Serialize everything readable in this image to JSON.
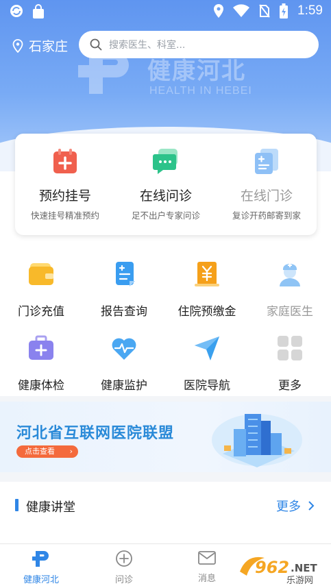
{
  "status_bar": {
    "time": "1:59"
  },
  "header": {
    "city": "石家庄",
    "search_placeholder": "搜索医生、科室...",
    "watermark_cn": "健康河北",
    "watermark_en": "HEALTH IN HEBEI"
  },
  "main_card": [
    {
      "title": "预约挂号",
      "subtitle": "快速挂号精准预约",
      "icon": "calendar-plus-icon",
      "color": "#f0604e"
    },
    {
      "title": "在线问诊",
      "subtitle": "足不出户专家问诊",
      "icon": "chat-bubble-icon",
      "color": "#2cc38a"
    },
    {
      "title": "在线门诊",
      "subtitle": "复诊开药邮寄到家",
      "icon": "document-icon",
      "color": "#8ec0f6"
    }
  ],
  "grid": [
    {
      "label": "门诊充值",
      "icon": "wallet-icon"
    },
    {
      "label": "报告查询",
      "icon": "report-icon"
    },
    {
      "label": "住院预缴金",
      "icon": "yuan-icon"
    },
    {
      "label": "家庭医生",
      "icon": "doctor-icon"
    },
    {
      "label": "健康体检",
      "icon": "medical-kit-icon"
    },
    {
      "label": "健康监护",
      "icon": "heart-pulse-icon"
    },
    {
      "label": "医院导航",
      "icon": "navigation-icon"
    },
    {
      "label": "更多",
      "icon": "more-grid-icon"
    }
  ],
  "banner": {
    "title": "河北省互联网医院联盟",
    "button": "点击查看"
  },
  "section": {
    "title": "健康讲堂",
    "more": "更多"
  },
  "tabs": [
    {
      "label": "健康河北",
      "icon": "home-logo-icon",
      "active": true
    },
    {
      "label": "问诊",
      "icon": "plus-circle-icon",
      "active": false
    },
    {
      "label": "消息",
      "icon": "mail-icon",
      "active": false
    }
  ],
  "corner_watermark": "962.NET 乐游网",
  "colors": {
    "primary": "#2f86e6",
    "header": "#6a9ff2",
    "banner_button": "#f46a3c"
  }
}
